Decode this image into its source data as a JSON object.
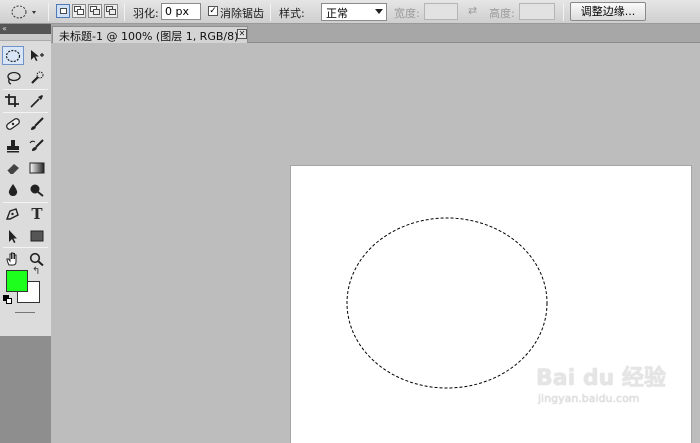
{
  "options_bar": {
    "feather_label": "羽化:",
    "feather_value": "0 px",
    "antialias_label": "消除锯齿",
    "antialias_checked": "✓",
    "style_label": "样式:",
    "style_value": "正常",
    "width_label": "宽度:",
    "height_label": "高度:",
    "refine_button": "调整边缘..."
  },
  "toolbox": {
    "header": "«",
    "foreground_color": "#1dff1d",
    "background_color": "#ffffff",
    "tools": [
      "elliptical-marquee-tool",
      "move-tool",
      "lasso-tool",
      "quick-selection-tool",
      "crop-tool",
      "eyedropper-tool",
      "spot-healing-brush-tool",
      "brush-tool",
      "clone-stamp-tool",
      "history-brush-tool",
      "eraser-tool",
      "gradient-tool",
      "blur-tool",
      "dodge-tool",
      "pen-tool",
      "type-tool",
      "path-selection-tool",
      "rectangle-tool",
      "hand-tool",
      "zoom-tool"
    ],
    "type_tool_glyph": "T"
  },
  "document": {
    "tab_title": "未标题-1 @ 100% (图层 1, RGB/8) *",
    "close_glyph": "✕"
  },
  "watermark": {
    "brand": "Bai du 经验",
    "url": "jingyan.baidu.com"
  }
}
